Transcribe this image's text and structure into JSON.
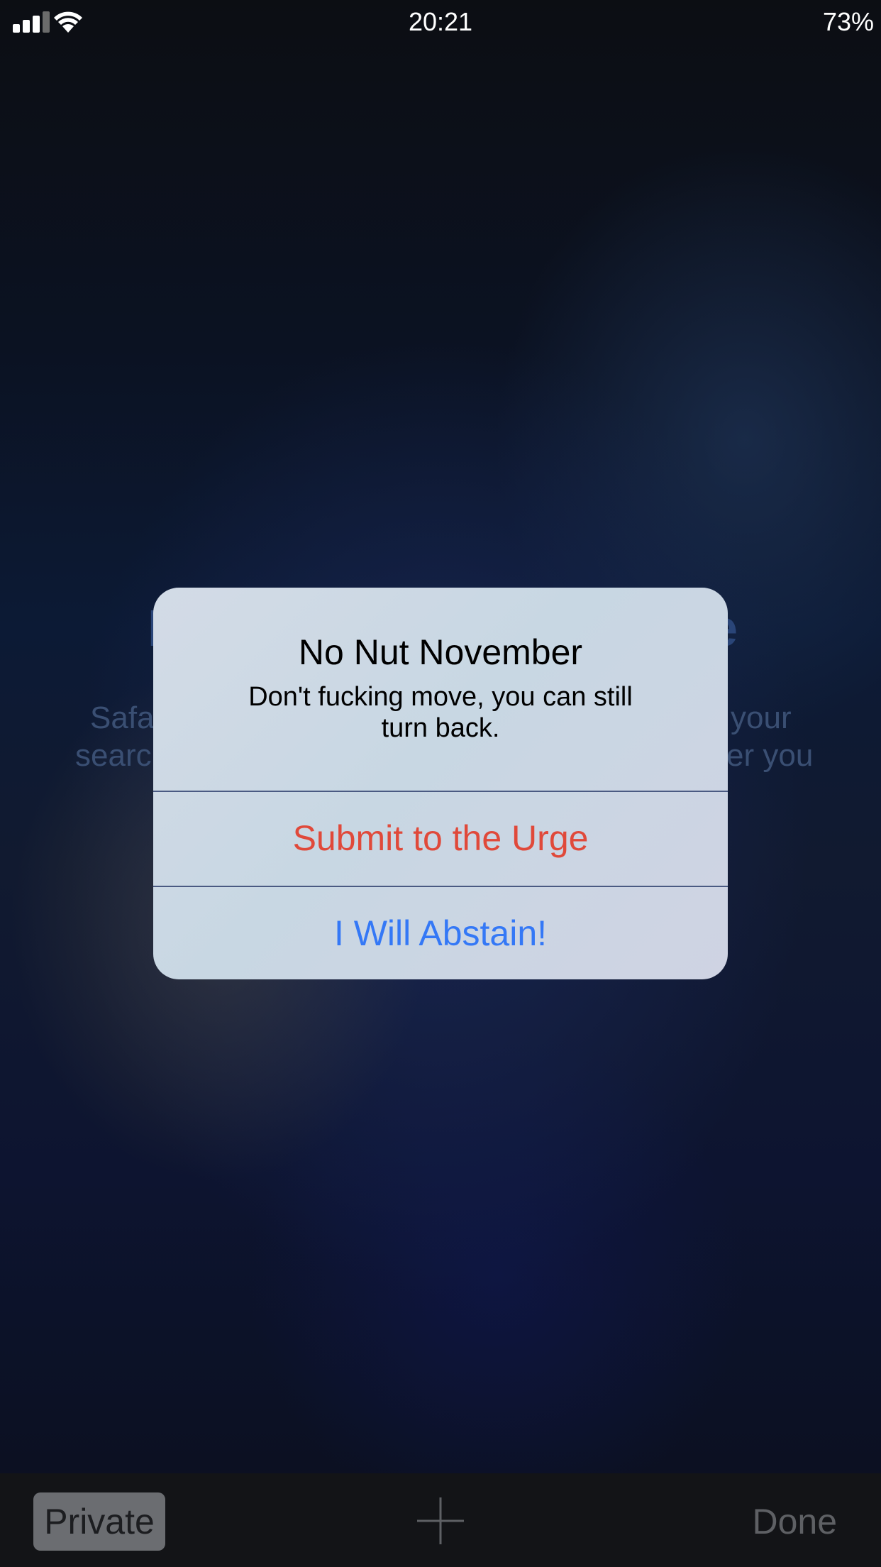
{
  "status_bar": {
    "time": "20:21",
    "battery": "73%",
    "signal_icon": "cellular-signal-icon",
    "wifi_icon": "wifi-icon"
  },
  "background_page": {
    "title_left_fragment": "P",
    "title_right_fragment": "e",
    "line1_left": "Safa",
    "line1_right": "your",
    "line2_left": "searc",
    "line2_right": "er you"
  },
  "alert": {
    "title": "No Nut November",
    "message": "Don't fucking move, you can still turn back.",
    "buttons": [
      {
        "label": "Submit to the Urge",
        "color": "#e0493a"
      },
      {
        "label": "I Will Abstain!",
        "color": "#3478f6"
      }
    ]
  },
  "toolbar": {
    "private_label": "Private",
    "new_tab_icon": "plus-icon",
    "done_label": "Done"
  }
}
